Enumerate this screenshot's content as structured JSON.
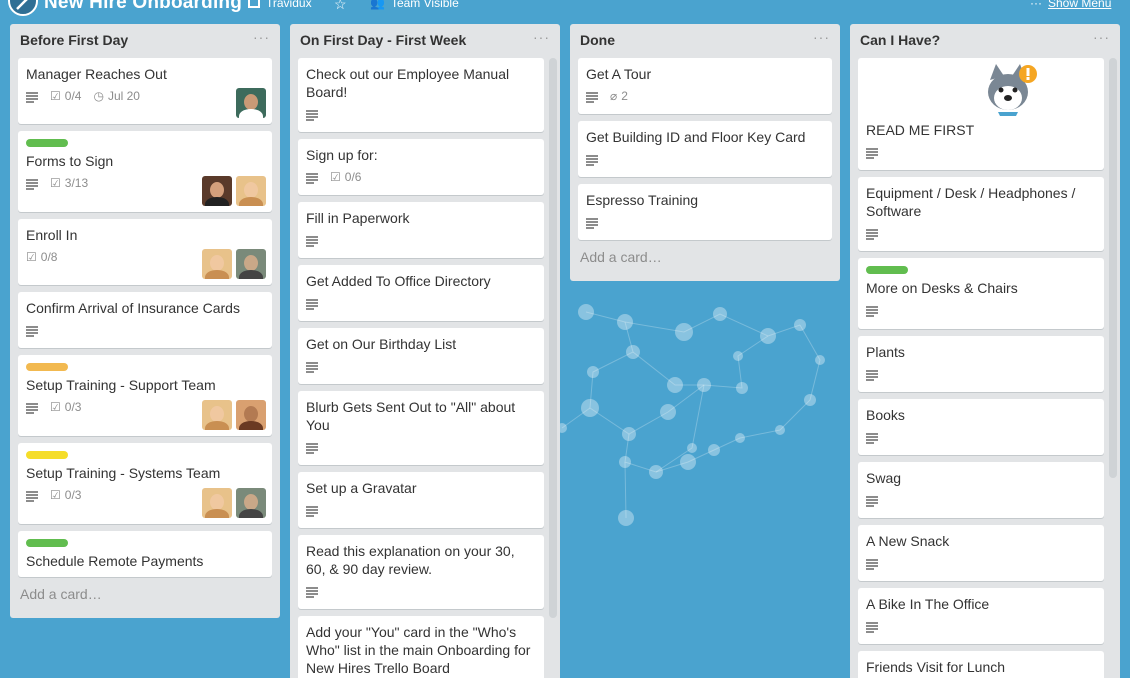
{
  "header": {
    "board_title": "New Hire Onboarding",
    "team_name": "Travidux",
    "visibility": "Team Visible",
    "show_menu": "Show Menu"
  },
  "colors": {
    "background": "#4aa3cf",
    "label_green": "#61bd4f",
    "label_orange": "#f2b950",
    "label_yellow": "#f5dd29"
  },
  "lists": [
    {
      "title": "Before First Day",
      "add_card": "Add a card…",
      "cards": [
        {
          "title": "Manager Reaches Out",
          "desc": true,
          "checklist": "0/4",
          "due": "Jul 20",
          "avatars": [
            "man-dark-hair"
          ]
        },
        {
          "title": "Forms to Sign",
          "label": "green",
          "desc": true,
          "checklist": "3/13",
          "avatars": [
            "woman-dark-hair",
            "woman-blonde"
          ]
        },
        {
          "title": "Enroll In",
          "checklist": "0/8",
          "avatars": [
            "woman-blonde",
            "man-glasses"
          ]
        },
        {
          "title": "Confirm Arrival of Insurance Cards",
          "desc": true
        },
        {
          "title": "Setup Training - Support Team",
          "label": "orange",
          "desc": true,
          "checklist": "0/3",
          "avatars": [
            "woman-blonde",
            "woman-brunette"
          ]
        },
        {
          "title": "Setup Training - Systems Team",
          "label": "yellow",
          "desc": true,
          "checklist": "0/3",
          "avatars": [
            "woman-blonde",
            "man-glasses"
          ]
        },
        {
          "title": "Schedule Remote Payments",
          "label": "green"
        }
      ]
    },
    {
      "title": "On First Day - First Week",
      "cards": [
        {
          "title": "Check out our Employee Manual Board!",
          "desc": true
        },
        {
          "title": "Sign up for:",
          "desc": true,
          "checklist": "0/6"
        },
        {
          "title": "Fill in Paperwork",
          "desc": true
        },
        {
          "title": "Get Added To Office Directory",
          "desc": true
        },
        {
          "title": "Get on Our Birthday List",
          "desc": true
        },
        {
          "title": "Blurb Gets Sent Out to \"All\" about You",
          "desc": true
        },
        {
          "title": "Set up a Gravatar",
          "desc": true
        },
        {
          "title": "Read this explanation on your 30, 60, & 90 day review.",
          "desc": true
        },
        {
          "title": "Add your \"You\" card in the \"Who's Who\" list in the main Onboarding for New Hires Trello Board"
        }
      ]
    },
    {
      "title": "Done",
      "add_card": "Add a card…",
      "cards": [
        {
          "title": "Get A Tour",
          "desc": true,
          "attachments": "2"
        },
        {
          "title": "Get Building ID and Floor Key Card",
          "desc": true
        },
        {
          "title": "Espresso Training",
          "desc": true
        }
      ]
    },
    {
      "title": "Can I Have?",
      "cards": [
        {
          "title": "READ ME FIRST",
          "desc": true,
          "cover": "husky-alert-sticker"
        },
        {
          "title": "Equipment / Desk / Headphones / Software",
          "desc": true
        },
        {
          "title": "More on Desks & Chairs",
          "label": "green",
          "desc": true
        },
        {
          "title": "Plants",
          "desc": true
        },
        {
          "title": "Books",
          "desc": true
        },
        {
          "title": "Swag",
          "desc": true
        },
        {
          "title": "A New Snack",
          "desc": true
        },
        {
          "title": "A Bike In The Office",
          "desc": true
        },
        {
          "title": "Friends Visit for Lunch"
        }
      ]
    }
  ]
}
